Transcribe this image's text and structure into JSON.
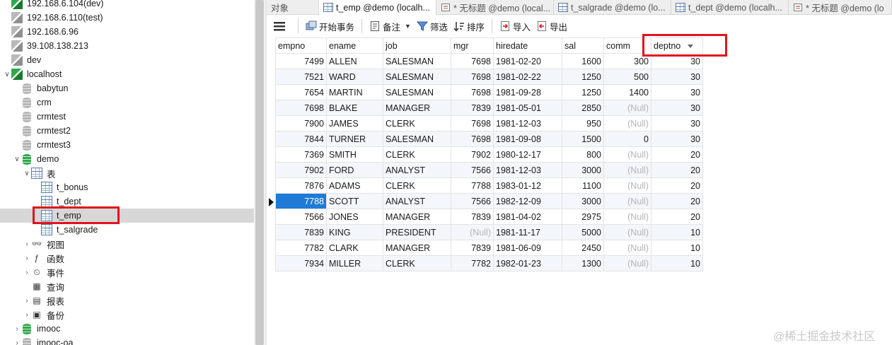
{
  "sidebar": {
    "items": [
      {
        "label": "192.168.6.104(dev)",
        "icon": "connection-icon-green"
      },
      {
        "label": "192.168.6.110(test)",
        "icon": "connection-icon"
      },
      {
        "label": "192.168.6.96",
        "icon": "connection-icon"
      },
      {
        "label": "39.108.138.213",
        "icon": "connection-icon"
      },
      {
        "label": "dev",
        "icon": "connection-icon"
      },
      {
        "label": "localhost",
        "icon": "connection-icon-green"
      },
      {
        "label": "babytun",
        "icon": "database-icon"
      },
      {
        "label": "crm",
        "icon": "database-icon"
      },
      {
        "label": "crmtest",
        "icon": "database-icon"
      },
      {
        "label": "crmtest2",
        "icon": "database-icon"
      },
      {
        "label": "crmtest3",
        "icon": "database-icon"
      },
      {
        "label": "demo",
        "icon": "database-icon-green"
      },
      {
        "label": "表",
        "icon": "tables-folder-icon"
      },
      {
        "label": "t_bonus",
        "icon": "table-icon"
      },
      {
        "label": "t_dept",
        "icon": "table-icon"
      },
      {
        "label": "t_emp",
        "icon": "table-icon"
      },
      {
        "label": "t_salgrade",
        "icon": "table-icon"
      },
      {
        "label": "视图",
        "icon": "views-icon"
      },
      {
        "label": "函数",
        "icon": "functions-icon"
      },
      {
        "label": "事件",
        "icon": "events-icon"
      },
      {
        "label": "查询",
        "icon": "queries-icon"
      },
      {
        "label": "报表",
        "icon": "reports-icon"
      },
      {
        "label": "备份",
        "icon": "backups-icon"
      },
      {
        "label": "imooc",
        "icon": "database-icon-green"
      },
      {
        "label": "imooc-oa",
        "icon": "database-icon"
      }
    ],
    "selected": "t_emp"
  },
  "tabs": [
    {
      "label": "对象"
    },
    {
      "label": "t_emp @demo (localh..."
    },
    {
      "label": "* 无标题 @demo (local..."
    },
    {
      "label": "t_salgrade @demo (lo..."
    },
    {
      "label": "t_dept @demo (localh..."
    },
    {
      "label": "* 无标题 @demo (lo"
    }
  ],
  "toolbar": {
    "begin_transaction": "开始事务",
    "memo": "备注",
    "filter": "筛选",
    "sort": "排序",
    "import": "导入",
    "export": "导出"
  },
  "grid": {
    "columns": [
      "empno",
      "ename",
      "job",
      "mgr",
      "hiredate",
      "sal",
      "comm",
      "deptno"
    ],
    "sorted_column": "deptno",
    "null_text": "(Null)",
    "rows": [
      [
        "7499",
        "ALLEN",
        "SALESMAN",
        "7698",
        "1981-02-20",
        "1600",
        "300",
        "30"
      ],
      [
        "7521",
        "WARD",
        "SALESMAN",
        "7698",
        "1981-02-22",
        "1250",
        "500",
        "30"
      ],
      [
        "7654",
        "MARTIN",
        "SALESMAN",
        "7698",
        "1981-09-28",
        "1250",
        "1400",
        "30"
      ],
      [
        "7698",
        "BLAKE",
        "MANAGER",
        "7839",
        "1981-05-01",
        "2850",
        null,
        "30"
      ],
      [
        "7900",
        "JAMES",
        "CLERK",
        "7698",
        "1981-12-03",
        "950",
        null,
        "30"
      ],
      [
        "7844",
        "TURNER",
        "SALESMAN",
        "7698",
        "1981-09-08",
        "1500",
        "0",
        "30"
      ],
      [
        "7369",
        "SMITH",
        "CLERK",
        "7902",
        "1980-12-17",
        "800",
        null,
        "20"
      ],
      [
        "7902",
        "FORD",
        "ANALYST",
        "7566",
        "1981-12-03",
        "3000",
        null,
        "20"
      ],
      [
        "7876",
        "ADAMS",
        "CLERK",
        "7788",
        "1983-01-12",
        "1100",
        null,
        "20"
      ],
      [
        "7788",
        "SCOTT",
        "ANALYST",
        "7566",
        "1982-12-09",
        "3000",
        null,
        "20"
      ],
      [
        "7566",
        "JONES",
        "MANAGER",
        "7839",
        "1981-04-02",
        "2975",
        null,
        "20"
      ],
      [
        "7839",
        "KING",
        "PRESIDENT",
        null,
        "1981-11-17",
        "5000",
        null,
        "10"
      ],
      [
        "7782",
        "CLARK",
        "MANAGER",
        "7839",
        "1981-06-09",
        "2450",
        null,
        "10"
      ],
      [
        "7934",
        "MILLER",
        "CLERK",
        "7782",
        "1982-01-23",
        "1300",
        null,
        "10"
      ]
    ],
    "current_row": 9
  },
  "watermark": "@稀土掘金技术社区",
  "colors": {
    "highlight": "#e0141e",
    "selection": "#1f7bd6",
    "accent_green": "#2fa84a"
  }
}
